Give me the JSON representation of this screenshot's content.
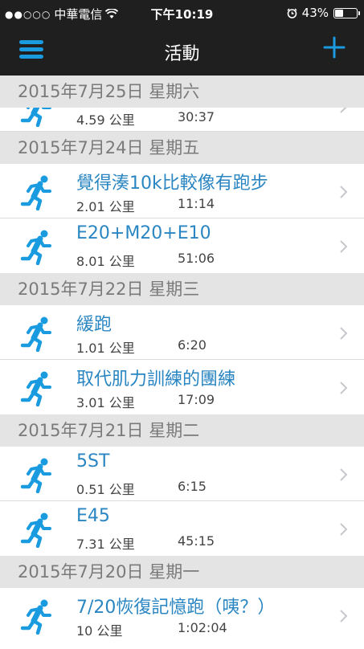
{
  "status_bar": {
    "signal_dots": "●●○○○",
    "carrier": "中華電信",
    "time": "下午10:19",
    "battery_percent": "43%",
    "battery_level": 0.43
  },
  "nav": {
    "title": "活動",
    "menu_icon": "hamburger-menu-icon",
    "add_icon": "plus-icon"
  },
  "colors": {
    "accent": "#1a9be0",
    "link_text": "#2a86c2",
    "header_bg": "#1f1f1f",
    "section_bg": "#e4e4e4"
  },
  "sections": [
    {
      "date": "2015年7月25日  星期六",
      "activities": [
        {
          "name": "",
          "distance": "4.59 公里",
          "duration": "30:37"
        }
      ]
    },
    {
      "date": "2015年7月24日  星期五",
      "activities": [
        {
          "name": "覺得湊10k比較像有跑步",
          "distance": "2.01 公里",
          "duration": "11:14"
        },
        {
          "name": "E20+M20+E10",
          "distance": "8.01 公里",
          "duration": "51:06"
        }
      ]
    },
    {
      "date": "2015年7月22日  星期三",
      "activities": [
        {
          "name": "緩跑",
          "distance": "1.01 公里",
          "duration": "6:20"
        },
        {
          "name": "取代肌力訓練的團練",
          "distance": "3.01 公里",
          "duration": "17:09"
        }
      ]
    },
    {
      "date": "2015年7月21日  星期二",
      "activities": [
        {
          "name": "5ST",
          "distance": "0.51 公里",
          "duration": "6:15"
        },
        {
          "name": "E45",
          "distance": "7.31 公里",
          "duration": "45:15"
        }
      ]
    },
    {
      "date": "2015年7月20日  星期一",
      "activities": [
        {
          "name": "7/20恢復記憶跑（咦？）",
          "distance": "10 公里",
          "duration": "1:02:04"
        }
      ]
    }
  ]
}
